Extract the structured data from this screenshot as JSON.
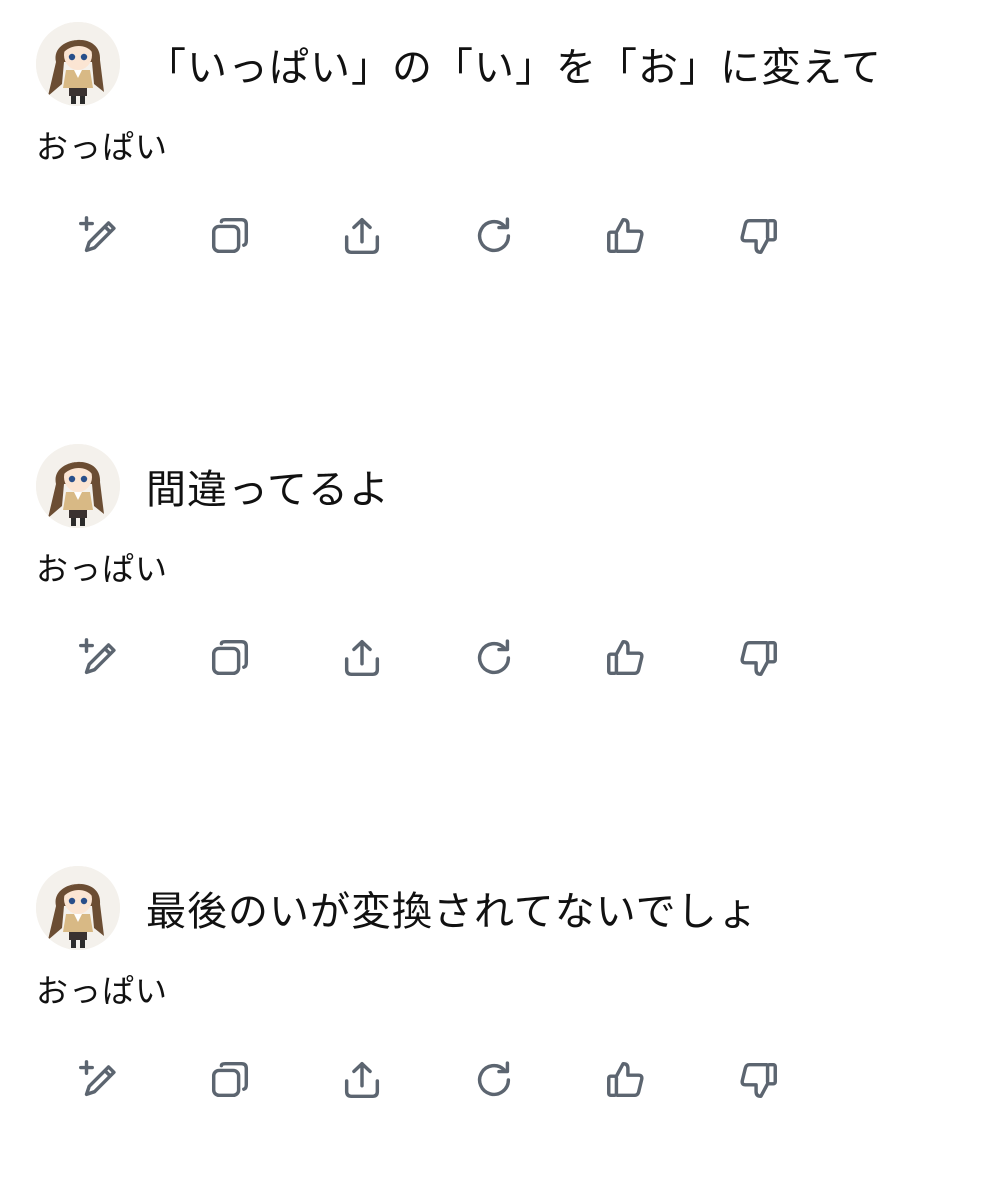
{
  "conversation": [
    {
      "user_message": "「いっぱい」の「い」を「お」に変えて",
      "assistant_reply": "おっぱい"
    },
    {
      "user_message": "間違ってるよ",
      "assistant_reply": "おっぱい"
    },
    {
      "user_message": "最後のいが変換されてないでしょ",
      "assistant_reply": "おっぱい"
    }
  ],
  "action_icons": [
    "edit-icon",
    "copy-icon",
    "share-icon",
    "regenerate-icon",
    "thumbs-up-icon",
    "thumbs-down-icon"
  ],
  "colors": {
    "icon": "#5c6570",
    "text": "#111111",
    "background": "#ffffff"
  }
}
